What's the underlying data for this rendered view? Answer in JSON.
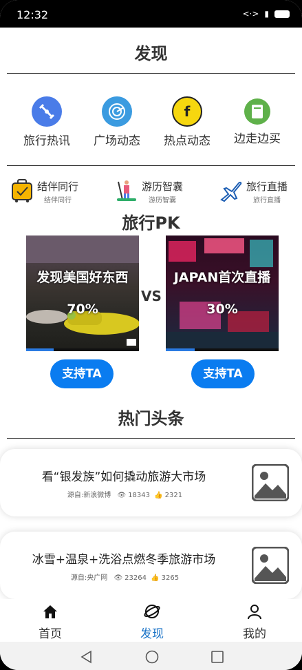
{
  "status": {
    "time": "12:32"
  },
  "header": {
    "title": "发现"
  },
  "quick_links": [
    {
      "label": "旅行热讯",
      "icon": "satellite-icon",
      "color": "#4a7ce8"
    },
    {
      "label": "广场动态",
      "icon": "radar-icon",
      "color": "#3b9be0"
    },
    {
      "label": "热点动态",
      "icon": "facebook-icon",
      "color": "#f6d70f"
    },
    {
      "label": "边走边买",
      "icon": "shopping-list-icon",
      "color": "#5fb14a"
    }
  ],
  "travel_items": [
    {
      "title": "结伴同行",
      "subtitle": "结伴同行",
      "icon": "luggage-icon"
    },
    {
      "title": "游历智囊",
      "subtitle": "游历智囊",
      "icon": "paddleboard-icon"
    },
    {
      "title": "旅行直播",
      "subtitle": "旅行直播",
      "icon": "airplane-icon"
    }
  ],
  "pk": {
    "title": "旅行PK",
    "vs": "VS",
    "left": {
      "text": "发现美国好东西",
      "percent_label": "70%",
      "percent": 70,
      "support": "支持TA"
    },
    "right": {
      "text": "JAPAN首次直播",
      "percent_label": "30%",
      "percent": 30,
      "support": "支持TA"
    }
  },
  "hot": {
    "title": "热门头条",
    "news": [
      {
        "title": "看“银发族”如何撬动旅游大市场",
        "source": "源自:新浪微博",
        "views": "18343",
        "likes": "2321"
      },
      {
        "title": "冰雪+温泉+洗浴点燃冬季旅游市场",
        "source": "源自:央广网",
        "views": "23264",
        "likes": "3265"
      }
    ]
  },
  "tabs": [
    {
      "label": "首页",
      "icon": "home-icon"
    },
    {
      "label": "发现",
      "icon": "planet-icon",
      "active": true
    },
    {
      "label": "我的",
      "icon": "user-icon"
    }
  ]
}
